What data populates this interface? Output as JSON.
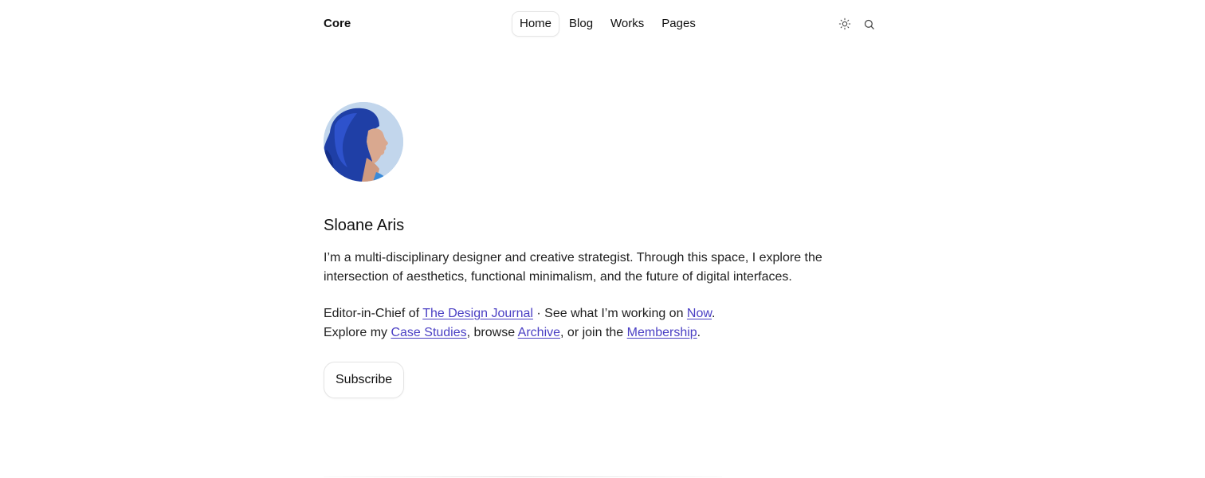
{
  "header": {
    "logo": "Core",
    "nav": [
      {
        "label": "Home",
        "active": true
      },
      {
        "label": "Blog",
        "active": false
      },
      {
        "label": "Works",
        "active": false
      },
      {
        "label": "Pages",
        "active": false
      }
    ],
    "icons": [
      "sun-icon",
      "search-icon"
    ]
  },
  "profile": {
    "name": "Sloane Aris",
    "bio": "I’m a multi-disciplinary designer and creative strategist. Through this space, I explore the intersection of aesthetics, functional minimalism, and the future of digital interfaces.",
    "line1": {
      "prefix": "Editor-in-Chief of ",
      "link1": "The Design Journal",
      "middle": " · See what I’m working on ",
      "link2": "Now",
      "suffix": "."
    },
    "line2": {
      "prefix": "Explore my ",
      "link1": "Case Studies",
      "sep1": ", browse ",
      "link2": "Archive",
      "sep2": ", or join the ",
      "link3": "Membership",
      "suffix": "."
    },
    "subscribe_label": "Subscribe"
  },
  "colors": {
    "link": "#4a3fc4",
    "text": "#1f1f1f",
    "border": "#e4e4e4"
  }
}
